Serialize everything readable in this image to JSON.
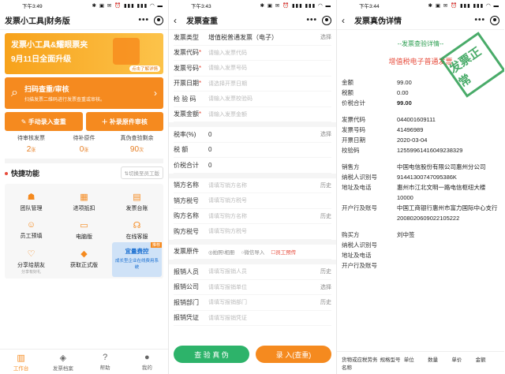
{
  "p1": {
    "time": "下午3:49",
    "status_icons": "✱ ▣ ✉ ⏰ ▮▮▮ ▮▮▮ ◠ ▬",
    "title": "发票小工具|财务版",
    "banner_l1": "发票小工具&耀眼票夹",
    "banner_l2": "9月11日全面升级",
    "banner_tag": "点击了解详情",
    "scan_title": "扫码查重/审核",
    "scan_sub": "扫描发票二维码进行发票查重或审核。",
    "manual_entry": "手动录入查重",
    "supplement": "补录原件审核",
    "stats": [
      {
        "label": "待审核发票",
        "value": "2",
        "unit": "张"
      },
      {
        "label": "待补原件",
        "value": "0",
        "unit": "张"
      },
      {
        "label": "真伪查验剩余",
        "value": "90",
        "unit": "次"
      }
    ],
    "quick": "快捷功能",
    "switch_label": "切换至员工版",
    "switch_prefix": "⇅",
    "grid": [
      {
        "icon": "users-icon",
        "glyph": "☗",
        "label": "团队管理",
        "sub": ""
      },
      {
        "icon": "deduct-icon",
        "glyph": "▦",
        "label": "进项抵扣",
        "sub": ""
      },
      {
        "icon": "ledger-icon",
        "glyph": "▤",
        "label": "发票台账",
        "sub": ""
      },
      {
        "icon": "employee-icon",
        "glyph": "☺",
        "label": "员工预填",
        "sub": ""
      },
      {
        "icon": "pc-icon",
        "glyph": "▭",
        "label": "电脑版",
        "sub": ""
      },
      {
        "icon": "service-icon",
        "glyph": "☊",
        "label": "在线客服",
        "sub": ""
      },
      {
        "icon": "share-icon",
        "glyph": "♡",
        "label": "分享给朋友",
        "sub": "分享有好礼"
      },
      {
        "icon": "diamond-icon",
        "glyph": "◆",
        "label": "获取正式版",
        "sub": ""
      }
    ],
    "promo_tag": "推荐",
    "promo_a": "宜量费控",
    "promo_b": "成长型企业在线费用系统",
    "tabs": [
      {
        "icon": "workbench-icon",
        "glyph": "▥",
        "label": "工作台"
      },
      {
        "icon": "archive-icon",
        "glyph": "◈",
        "label": "发票档案"
      },
      {
        "icon": "help-icon",
        "glyph": "?",
        "label": "帮助"
      },
      {
        "icon": "mine-icon",
        "glyph": "●",
        "label": "我的"
      }
    ]
  },
  "p2": {
    "time": "下午3:43",
    "status_icons": "✱ ▣ ✉ ⏰ ▮▮▮ ▮▮▮ ◠ ▬",
    "title": "发票查重",
    "type_label": "发票类型",
    "type_value": "增值税普通发票（电子）",
    "select": "选择",
    "fields": [
      {
        "k": "发票代码",
        "ph": "请输入发票代码"
      },
      {
        "k": "发票号码",
        "ph": "请输入发票号码"
      },
      {
        "k": "开票日期",
        "ph": "请选择开票日期"
      },
      {
        "k": "检 验 码",
        "ph": "请输入发票校验码"
      },
      {
        "k": "发票金额",
        "ph": "请输入发票金额"
      }
    ],
    "tax_rate_label": "税率(%)",
    "tax_rate_value": "0",
    "tax_label": "税     额",
    "tax_value": "0",
    "total_label": "价税合计",
    "total_value": "0",
    "party_fields": [
      {
        "k": "销方名称",
        "ph": "请填写销方名称",
        "r": "历史"
      },
      {
        "k": "销方税号",
        "ph": "请填写销方税号",
        "r": ""
      },
      {
        "k": "购方名称",
        "ph": "请填写购方名称",
        "r": "历史"
      },
      {
        "k": "购方税号",
        "ph": "请填写购方税号",
        "r": ""
      }
    ],
    "orig_label": "发票原件",
    "orig_opts": [
      "◎拍照\\相册",
      "○微信导入",
      "☐员工预传"
    ],
    "report_fields": [
      {
        "k": "报销人员",
        "ph": "请填写报销人员",
        "r": "历史"
      },
      {
        "k": "报销公司",
        "ph": "请填写报销单位",
        "r": "选择"
      },
      {
        "k": "报销部门",
        "ph": "请填写报销部门",
        "r": "历史"
      },
      {
        "k": "报销凭证",
        "ph": "请填写报销凭证",
        "r": ""
      }
    ],
    "btn_verify": "查 验 真 伪",
    "btn_enter": "录 入(查重)"
  },
  "p3": {
    "time": "下午3:44",
    "status_icons": "✱ ▣ ✉ ⏰ ▮▮▮ ▮▮▮ ◠ ▬",
    "title": "发票真伪详情",
    "detail_title": "--发票查验详情--",
    "invoice_type": "增值税电子普通发票",
    "stamp": "发票正常",
    "rows_a": [
      {
        "k": "金额",
        "v": "99.00",
        "b": false
      },
      {
        "k": "税额",
        "v": "0.00",
        "b": false
      },
      {
        "k": "价税合计",
        "v": "99.00",
        "b": true
      }
    ],
    "rows_b": [
      {
        "k": "发票代码",
        "v": "044001609111"
      },
      {
        "k": "发票号码",
        "v": "41496989"
      },
      {
        "k": "开票日期",
        "v": "2020-03-04"
      },
      {
        "k": "校验码",
        "v": "12559961416049238329"
      }
    ],
    "seller": "中国电信股份有限公司惠州分公司",
    "seller_label": "销售方",
    "taxid_label": "纳税人识别号",
    "taxid": "91441300747095386K",
    "addr_label": "地址及电话",
    "addr": "惠州市江北文明一路电信枢纽大楼10000",
    "bank_label": "开户行及账号",
    "bank": "中国工商银行惠州市富力国际中心支行 2008020609022105222",
    "buyer_label": "购买方",
    "buyer": "刘中签",
    "buyer_taxid_label": "纳税人识别号",
    "buyer_addr_label": "地址及电话",
    "buyer_bank_label": "开户行及账号",
    "table_headers": [
      "货物或应税劳务名称",
      "规格型号",
      "单位",
      "数量",
      "单价",
      "金额"
    ]
  }
}
